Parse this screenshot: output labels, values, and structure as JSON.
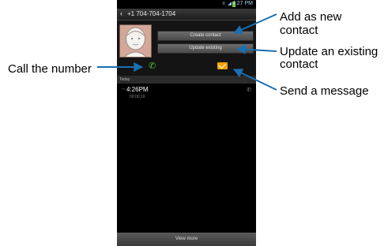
{
  "status_bar": {
    "time": "4:27 PM",
    "icons": "≡ ◢"
  },
  "title_bar": {
    "number": "+1 704-704-1704",
    "back_icon": "‹"
  },
  "contact": {
    "create_contact_label": "Create contact",
    "update_existing_label": "Update existing"
  },
  "actions": {
    "call_icon": "✆"
  },
  "log": {
    "section": "Today",
    "entries": [
      {
        "time": "4:26PM",
        "duration": "00:00:19",
        "arrow": "→",
        "call_icon": "✆"
      }
    ]
  },
  "bottom": {
    "view_more_label": "View more"
  },
  "callouts": {
    "add_line1": "Add as new",
    "add_line2": "contact",
    "update_line1": "Update an existing",
    "update_line2": "contact",
    "send": "Send a message",
    "call": "Call the number"
  },
  "colors": {
    "call_green": "#56c03a",
    "message_orange": "#f2a100",
    "screen_background": "#000000"
  }
}
